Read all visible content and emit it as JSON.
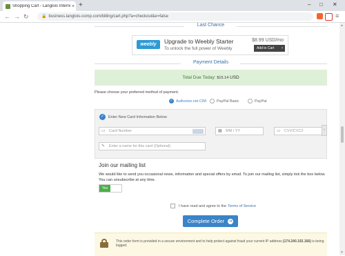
{
  "browser": {
    "tab_title": "Shopping Cart - Langlois Internet",
    "tab_close": "×",
    "new_tab": "+",
    "url": "business.langlois-comp.com/billing/cart.php?a=checkout&e=false",
    "win_min": "–",
    "win_max": "□",
    "win_close": "✕"
  },
  "last_chance": {
    "heading": "Last Chance",
    "logo_text": "weebly",
    "promo_title": "Upgrade to Weebly Starter",
    "promo_sub": "To unlock the full power of Weebly",
    "price": "$8.99 USD/mo",
    "cart_button": "Add to Cart"
  },
  "payment": {
    "heading": "Payment Details",
    "total_label": "Total Due Today:",
    "total_amount": "$15.14",
    "total_currency": "USD",
    "choose_method": "Please choose your preferred method of payment.",
    "methods": [
      "Authorize.net CIM",
      "PayPal Basic",
      "PayPal"
    ],
    "selected_method": "Authorize.net CIM",
    "enter_new_card": "Enter New Card Information Below",
    "card_number_placeholder": "Card Number",
    "expiry_placeholder": "MM / YY",
    "cvv_placeholder": "CVV/CVC2",
    "card_name_placeholder": "Enter a name for this card (Optional)"
  },
  "mailing": {
    "title": "Join our mailing list",
    "text": "We would like to send you occasional news, information and special offers by email. To join our mailing list, simply tick the box below. You can unsubscribe at any time.",
    "toggle_label": "Yes"
  },
  "terms": {
    "prefix": "I have read and agree to the",
    "link": "Terms of Service"
  },
  "complete_button": "Complete Order",
  "secure_notice": {
    "text": "This order form is provided in a secure environment and to help protect against fraud your current IP address",
    "ip": "(174.240.192.166)",
    "suffix": "is being logged."
  },
  "colors": {
    "accent": "#3a84c8",
    "success_bg": "#dff0d8",
    "toggle_on": "#4cae4c",
    "notice_bg": "#fcf8e3"
  }
}
